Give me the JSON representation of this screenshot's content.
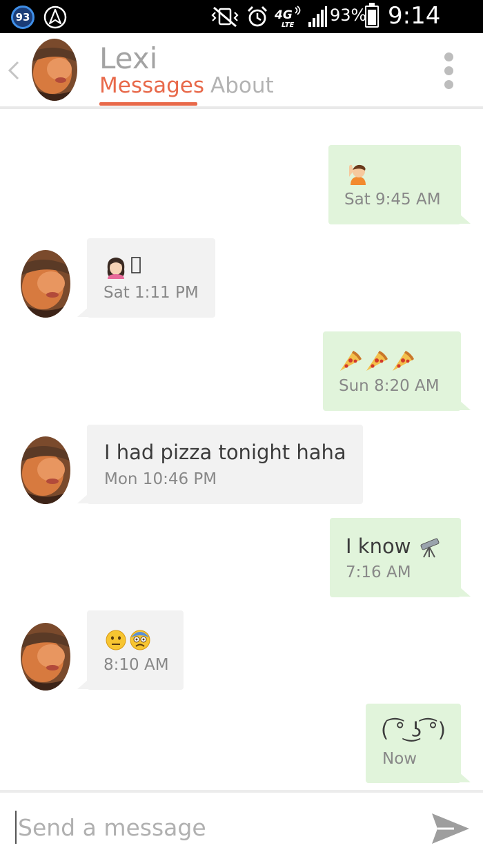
{
  "status_bar": {
    "badge": "93",
    "battery": "93%",
    "battery_level": 0.93,
    "time": "9:14 AM"
  },
  "header": {
    "contact_name": "Lexi",
    "tabs": [
      {
        "label": "Messages",
        "active": true
      },
      {
        "label": "About",
        "active": false
      }
    ]
  },
  "messages": [
    {
      "direction": "outgoing",
      "text": "",
      "emoji": [
        "man-raising-hand-emoji"
      ],
      "time": "Sat 9:45 AM"
    },
    {
      "direction": "incoming",
      "text": "",
      "emoji": [
        "woman-emoji",
        "missing-glyph"
      ],
      "time": "Sat 1:11 PM"
    },
    {
      "direction": "outgoing",
      "text": "",
      "emoji": [
        "pizza-emoji",
        "pizza-emoji",
        "pizza-emoji"
      ],
      "time": "Sun 8:20 AM"
    },
    {
      "direction": "incoming",
      "text": "I had pizza tonight haha",
      "emoji": [],
      "time": "Mon 10:46 PM"
    },
    {
      "direction": "outgoing",
      "text": "I know",
      "emoji": [
        "telescope-emoji"
      ],
      "time": "7:16 AM"
    },
    {
      "direction": "incoming",
      "text": "",
      "emoji": [
        "neutral-face-emoji",
        "fearful-face-emoji"
      ],
      "time": "8:10 AM"
    },
    {
      "direction": "outgoing",
      "text": "( ͡° ͜ʖ ͡°)",
      "emoji": [],
      "time": "Now"
    }
  ],
  "composer": {
    "placeholder": "Send a message"
  },
  "colors": {
    "accent": "#e8694a",
    "outgoing_bubble": "#e1f4db",
    "incoming_bubble": "#f2f2f2"
  }
}
